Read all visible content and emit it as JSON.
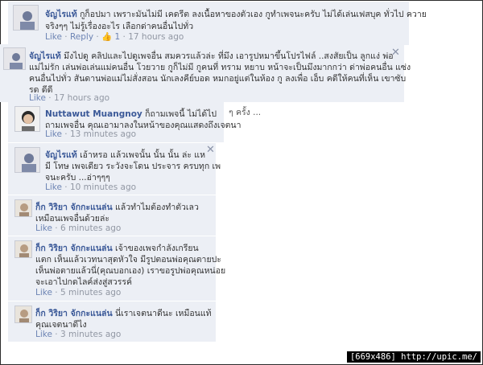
{
  "comments": [
    {
      "author": "จัญไรแท้",
      "lines": [
        "กูก็อปมา เพราะมันไม่มี เคดรีต ลงเนื้อหาของตัวเอง กูทำเพจนะครับ ไม่ได้เล่นเฟสบุค ทั่วไป ควาย",
        "จริงๆๆ ไม่รู้เรื่องอะไร เลือกด่าคนอื่นไปทั่ว"
      ],
      "like": "Like",
      "reply": "Reply",
      "like_count": "1",
      "time": "17 hours ago"
    },
    {
      "author": "จัญไรแท้",
      "lines": [
        "มึงไปดู คลิปและไปดูเพจอื่น สมควรแล้วล่ะ ที่มึง เอารูปหมาขึ้นโปรไฟล์ ..สงสัยเป็น ลูกแง่ พ่อ",
        "แม่ไม่รัก เล่นพ่อเล่นแม่คนอื่น โวยวาย กูก็ไม่มี กูคนที่ ทราม หยาบ หน้าจะเป็นมึงมากกว่า ด่าพ่อคนอื่น แซ่ง",
        "คนอื่นไปทั่ว สันดานพ่อแม่ไม่สั่งสอน นักเลงคีย์บอด หมกอยู่แต่ในห้อง กู ลงเพื่อ เอ็บ คดีให้คนที่เห็น เขาซับ",
        "รด ดีดี"
      ],
      "like": "Like",
      "time": "17 hours ago"
    },
    {
      "author": "Nuttawut Muangnoy",
      "lines": [
        "ก็ถามเพจนี้ ไม่ได้ไป",
        "ถามเพจอื่น คุณเอามาลงในหน้าของคุณแสดงถึงเจตนา"
      ],
      "like": "Like",
      "time": "13 minutes ago"
    },
    {
      "author": "จัญไรแท้",
      "lines": [
        "เอ้าหรอ แล้วเพจนั้น นั้น นั้น ล่ะ แห",
        "มี โทษ เพจเดียว ระวังจะโดน ประจาร ครบทุก เพ",
        "จนะครับ ...อ่าๆๆๆ"
      ],
      "like": "Like",
      "time": "10 minutes ago"
    },
    {
      "author": "ก็ก วิริยา จักกะแนล่น",
      "lines": [
        "แล้วทำไมต้องทำตัวเลว",
        "เหมือนเพจอื่นด้วยล่ะ"
      ],
      "like": "Like",
      "time": "6 minutes ago"
    },
    {
      "author": "ก็ก วิริยา จักกะแนล่น",
      "lines": [
        "เจ้าของเพจกำลังเกรียน",
        "แตก เห็นแล้วเวทนาสุดหัวใจ มีรูปตอนพ่อคุณตายปะ",
        "เห็นพ่อตายแล้วนี่(คุณบอกเอง) เราขอรูปพ่อคุณหน่อย",
        "จะเอาไปกดไลค์ส่งสู่สวรรค์"
      ],
      "like": "Like",
      "time": "5 minutes ago"
    },
    {
      "author": "ก็ก วิริยา จักกะแนล่น",
      "lines": [
        "นี่เราเจตนาดีนะ เหมือนแท้",
        "คุณเจตนาดีไง"
      ],
      "like": "Like",
      "time": "3 minutes ago"
    }
  ],
  "close_glyph": "✕",
  "sep": "·",
  "cut_text": "ๆ ครั้ง ...",
  "watermark": "[669x486] http://upic.me/",
  "colors": {
    "block_bg": "#eceff5",
    "author": "#3b5998",
    "meta": "#9197a3"
  }
}
